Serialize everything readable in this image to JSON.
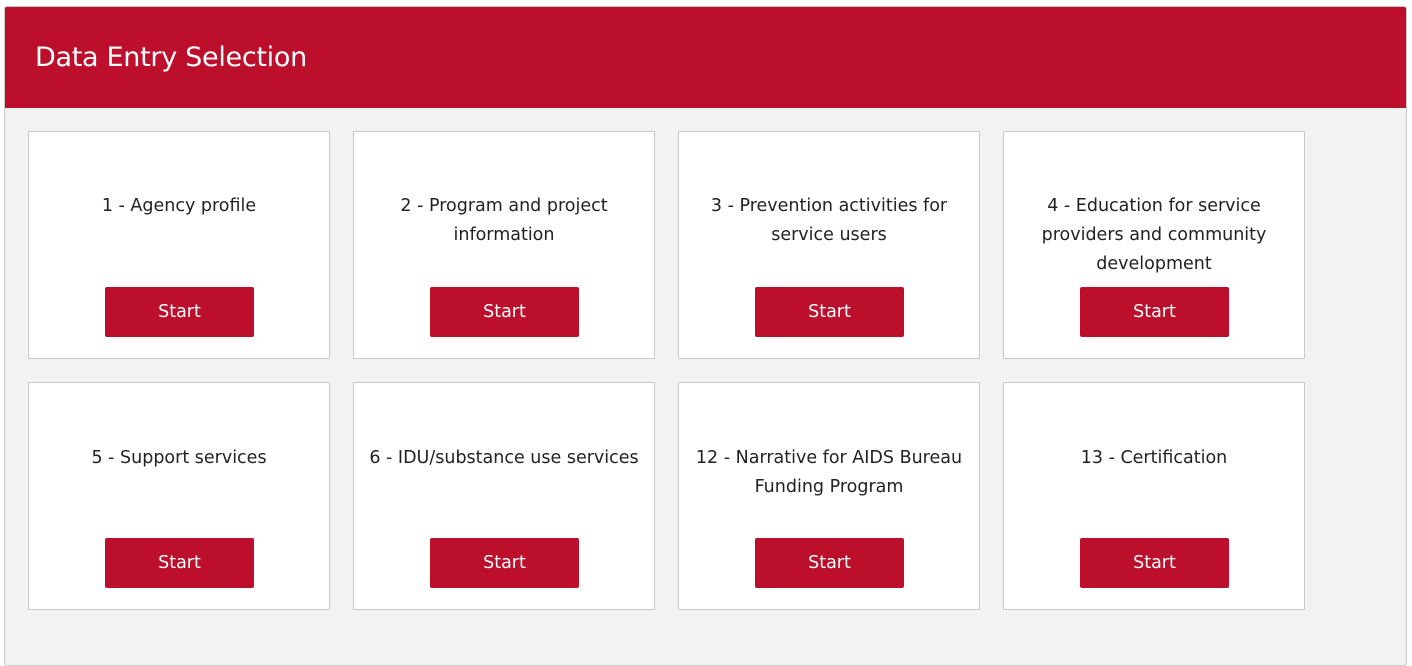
{
  "panel": {
    "title": "Data Entry Selection"
  },
  "colors": {
    "accent": "#bb0f2c",
    "panel_background": "#f2f2f2",
    "card_border": "#c9c9c9"
  },
  "cards": [
    {
      "label": "1 - Agency profile",
      "button": "Start"
    },
    {
      "label": "2 - Program and project information",
      "button": "Start"
    },
    {
      "label": "3 - Prevention activities for service users",
      "button": "Start"
    },
    {
      "label": "4 - Education for service providers and community development",
      "button": "Start"
    },
    {
      "label": "5 - Support services",
      "button": "Start"
    },
    {
      "label": "6 - IDU/substance use services",
      "button": "Start"
    },
    {
      "label": "12 - Narrative for AIDS Bureau Funding Program",
      "button": "Start"
    },
    {
      "label": "13 - Certification",
      "button": "Start"
    }
  ]
}
